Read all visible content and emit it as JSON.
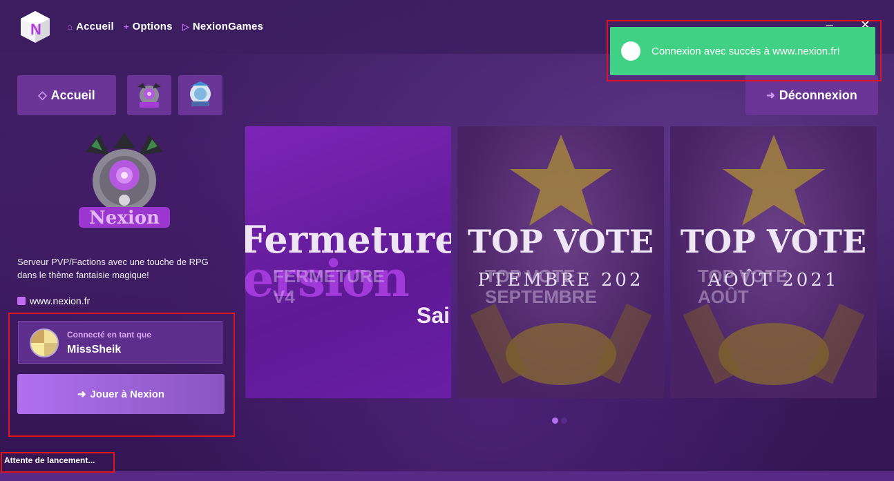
{
  "nav": {
    "items": [
      {
        "icon": "home-icon",
        "label": "Accueil"
      },
      {
        "icon": "plus-icon",
        "label": "Options"
      },
      {
        "icon": "play-icon",
        "label": "NexionGames"
      }
    ],
    "window_controls": [
      "minimize",
      "close"
    ]
  },
  "toolbar": {
    "home_label": "Accueil",
    "logout_label": "Déconnexion"
  },
  "server": {
    "description": "Serveur PVP/Factions avec une touche de RPG dans le thème fantaisie magique!",
    "website": "www.nexion.fr"
  },
  "user": {
    "connected_label": "Connecté en tant que",
    "name": "MissSheik"
  },
  "play_button": "Jouer à Nexion",
  "news": [
    {
      "headline_1": "Fermeture",
      "headline_2": "ersion",
      "headline_3": "Sai",
      "ghost_1": "FERMETURE",
      "ghost_2": "V4"
    },
    {
      "headline": "TOP VOTE",
      "subtitle": "PTEMBRE 202",
      "ghost_1": "TOP VOTE",
      "ghost_2": "SEPTEMBRE"
    },
    {
      "headline": "TOP VOTE",
      "subtitle": "AOÛT 2021",
      "ghost_1": "TOP VOTE",
      "ghost_2": "AOÛT"
    }
  ],
  "carousel": {
    "count": 2,
    "active": 0
  },
  "toast": {
    "message": "Connexion avec succès à www.nexion.fr!",
    "color": "#41d184"
  },
  "status": "Attente de lancement...",
  "colors": {
    "accent": "#6a3597",
    "highlight": "#c06cf0",
    "annotation": "#e0141e"
  }
}
